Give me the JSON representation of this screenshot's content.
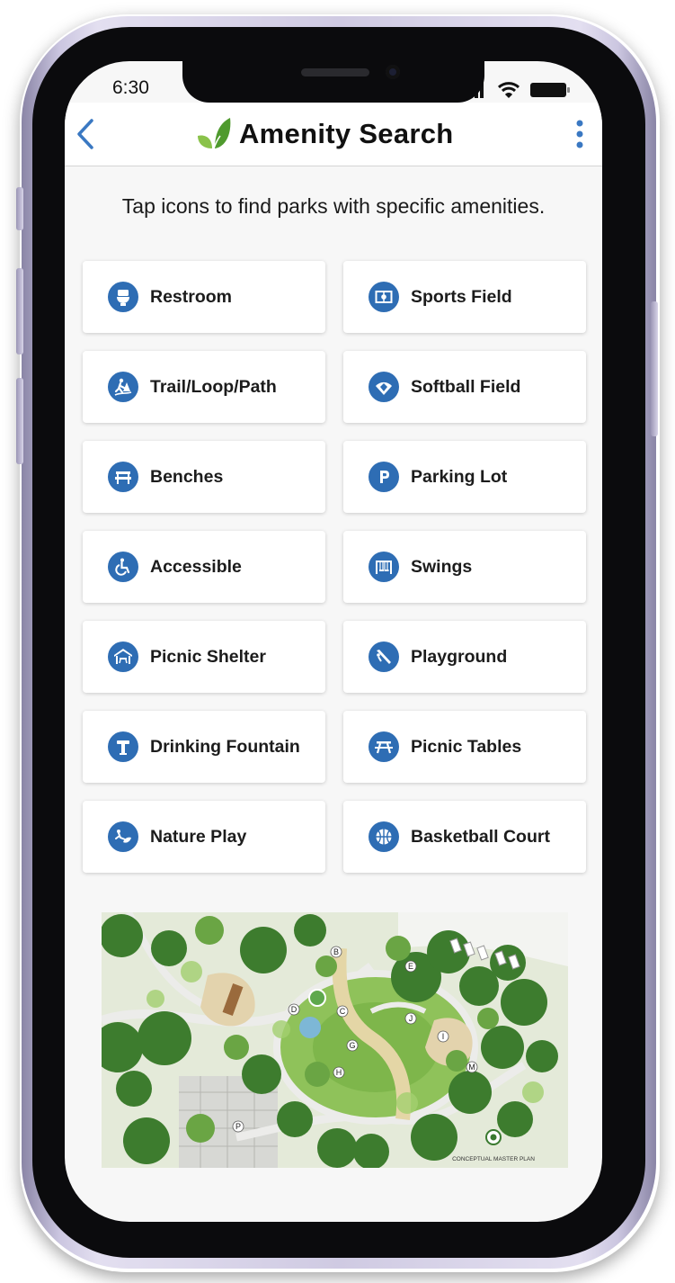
{
  "status": {
    "time": "6:30"
  },
  "header": {
    "title": "Amenity Search"
  },
  "instruction": "Tap icons to find parks with specific amenities.",
  "amenities": [
    {
      "label": "Restroom"
    },
    {
      "label": "Sports Field"
    },
    {
      "label": "Trail/Loop/Path"
    },
    {
      "label": "Softball Field"
    },
    {
      "label": "Benches"
    },
    {
      "label": "Parking Lot"
    },
    {
      "label": "Accessible"
    },
    {
      "label": "Swings"
    },
    {
      "label": "Picnic Shelter"
    },
    {
      "label": "Playground"
    },
    {
      "label": "Drinking Fountain"
    },
    {
      "label": "Picnic Tables"
    },
    {
      "label": "Nature Play"
    },
    {
      "label": "Basketball Court"
    }
  ],
  "map": {
    "labels": [
      "B",
      "C",
      "D",
      "E",
      "G",
      "H",
      "I",
      "J",
      "M",
      "P"
    ],
    "caption": "CONCEPTUAL MASTER PLAN"
  },
  "colors": {
    "accent": "#2e6db4",
    "nav_blue": "#3a78c2",
    "leaf_green": "#6fb33c"
  },
  "icons": [
    "back-chevron-icon",
    "leaf-logo-icon",
    "more-vertical-icon",
    "signal-icon",
    "wifi-icon",
    "battery-icon"
  ]
}
